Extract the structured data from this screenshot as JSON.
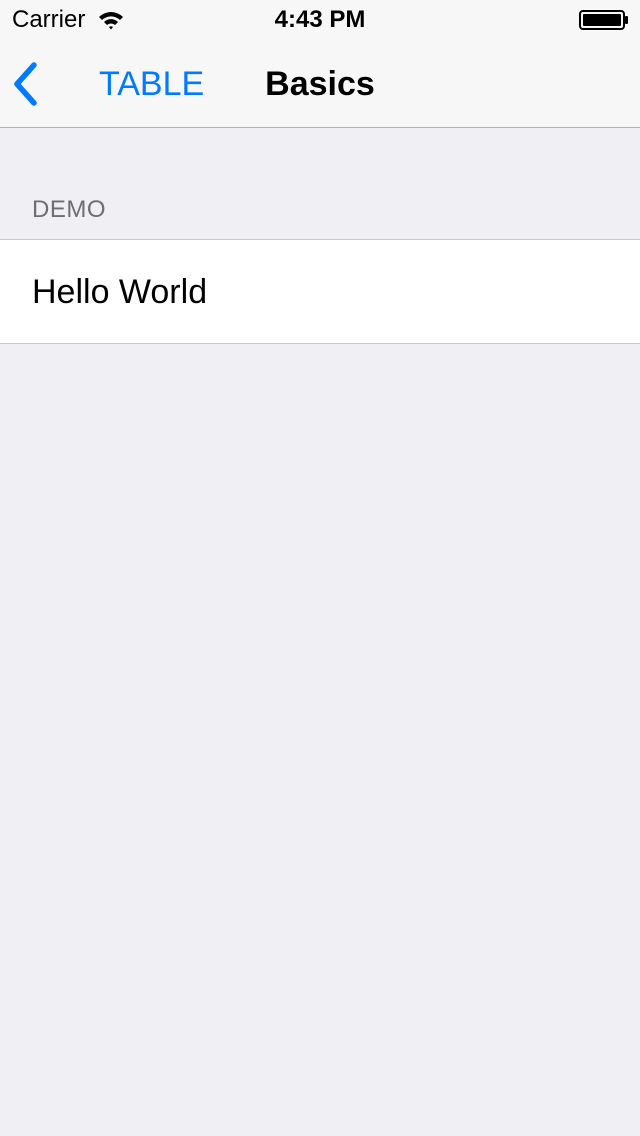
{
  "status_bar": {
    "carrier": "Carrier",
    "time": "4:43 PM",
    "wifi_icon": "wifi-icon",
    "battery_icon": "battery-icon"
  },
  "nav_bar": {
    "back_icon": "chevron-left-icon",
    "back_label": "TABLE",
    "title": "Basics"
  },
  "table": {
    "sections": [
      {
        "header": "DEMO",
        "rows": [
          {
            "label": "Hello World"
          }
        ]
      }
    ]
  },
  "colors": {
    "accent": "#007aff",
    "background": "#efeff4",
    "bar_background": "#f7f7f8",
    "section_header": "#6d6d72",
    "separator": "#c8c7cc"
  }
}
